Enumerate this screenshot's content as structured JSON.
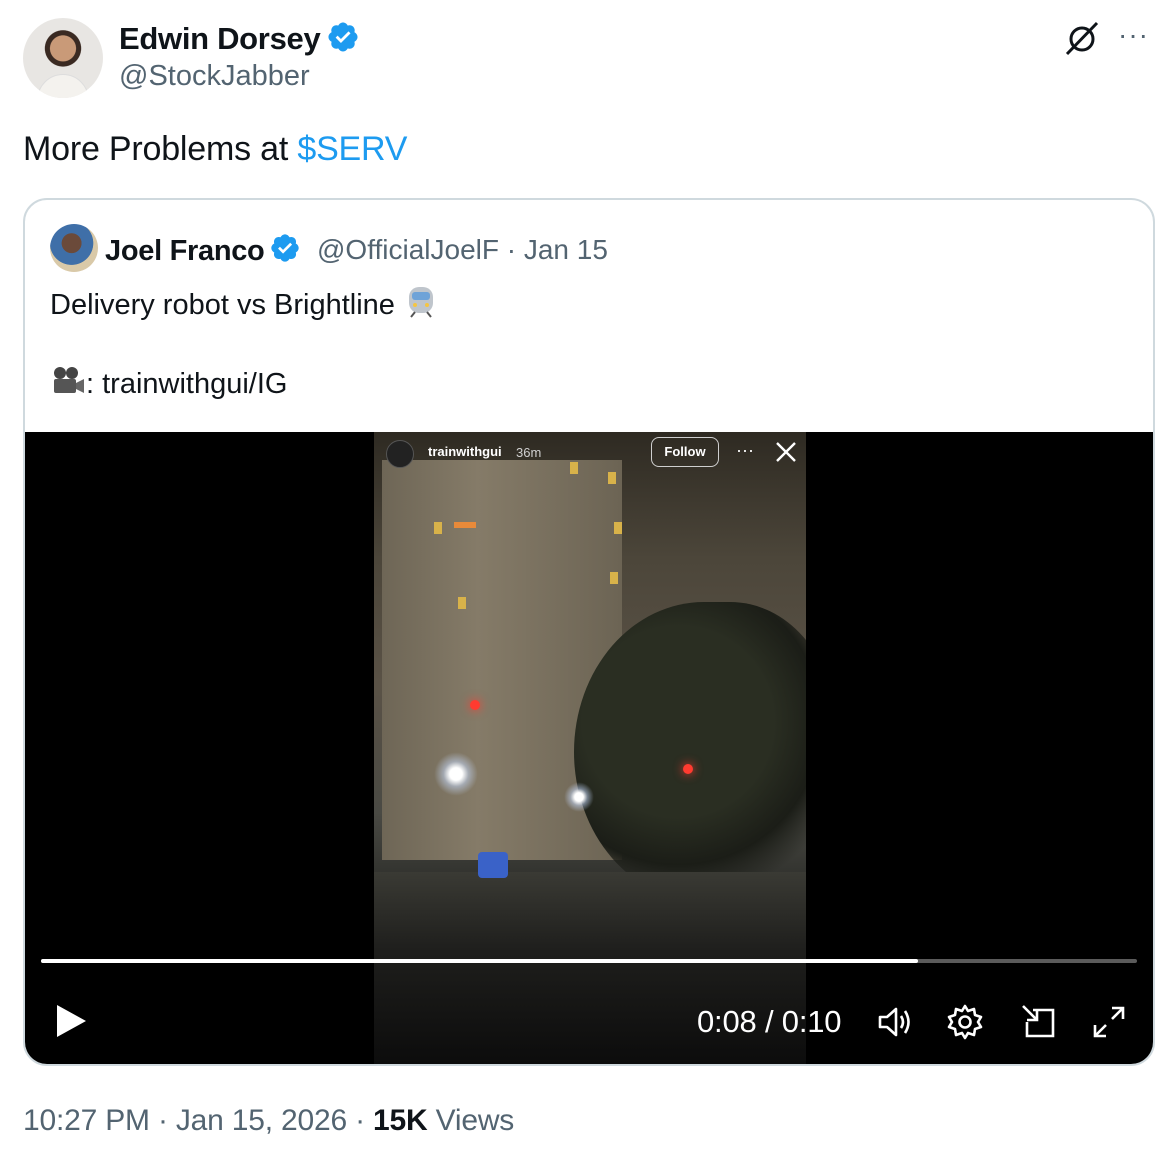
{
  "author": {
    "name": "Edwin Dorsey",
    "handle": "@StockJabber",
    "verified_color": "#1d9bf0"
  },
  "header_actions": {
    "grok_icon": "grok-icon",
    "more_label": "···"
  },
  "tweet": {
    "text": "More Problems at ",
    "cashtag": "$SERV",
    "accent_color": "#1d9bf0"
  },
  "quote": {
    "name": "Joel Franco",
    "handle": "@OfficialJoelF",
    "separator": "·",
    "date": "Jan 15",
    "line1": "Delivery robot vs Brightline",
    "line2": ": trainwithgui/IG"
  },
  "video": {
    "ig_user": "trainwithgui",
    "ig_time": "36m",
    "ig_follow": "Follow",
    "ig_more": "···",
    "current_time": "0:08",
    "duration": "0:10",
    "time_separator": " / ",
    "progress": 0.8
  },
  "footer": {
    "time": "10:27 PM",
    "sep1": " · ",
    "date": "Jan 15, 2026",
    "sep2": " · ",
    "views_count": "15K",
    "views_label": " Views"
  }
}
